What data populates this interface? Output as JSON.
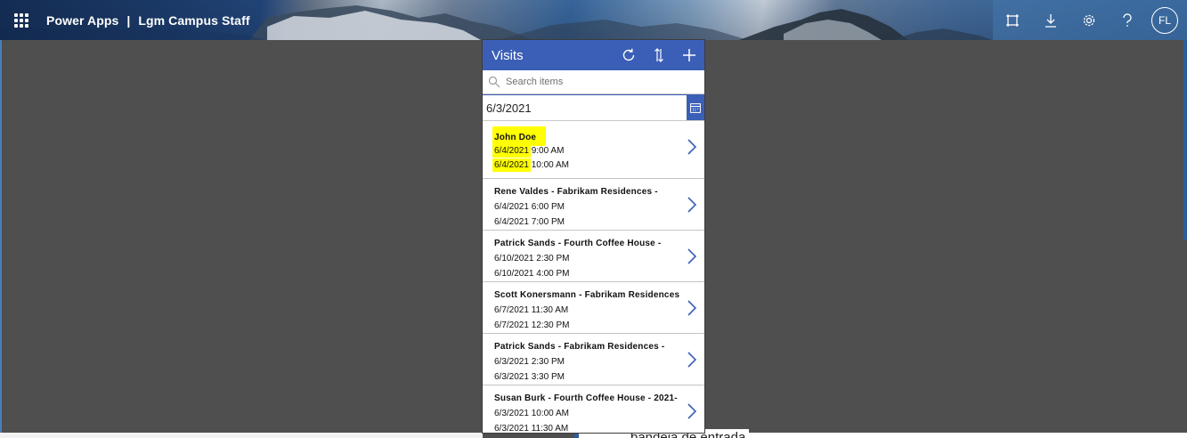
{
  "header": {
    "app_name": "Power Apps",
    "separator": "|",
    "environment": "Lgm Campus Staff",
    "avatar_initials": "FL",
    "icons": [
      "waffle-icon",
      "fit-screen-icon",
      "download-icon",
      "settings-icon",
      "help-icon"
    ]
  },
  "background_page": {
    "partial_text": "bandeja de entrada"
  },
  "app": {
    "title": "Visits",
    "search_placeholder": "Search items",
    "date_value": "6/3/2021",
    "accent_color": "#3b5fb7",
    "highlight_color": "#ffff00",
    "items": [
      {
        "name": "John Doe",
        "start": "6/4/2021 9:00 AM",
        "end": "6/4/2021 10:00 AM"
      },
      {
        "name": "Rene Valdes - Fabrikam Residences -",
        "start": "6/4/2021 6:00 PM",
        "end": "6/4/2021 7:00 PM"
      },
      {
        "name": "Patrick Sands - Fourth Coffee House -",
        "start": "6/10/2021 2:30 PM",
        "end": "6/10/2021 4:00 PM"
      },
      {
        "name": "Scott Konersmann - Fabrikam Residences",
        "start": "6/7/2021 11:30 AM",
        "end": "6/7/2021 12:30 PM"
      },
      {
        "name": "Patrick Sands - Fabrikam Residences -",
        "start": "6/3/2021 2:30 PM",
        "end": "6/3/2021 3:30 PM"
      },
      {
        "name": "Susan Burk - Fourth Coffee House - 2021-",
        "start": "6/3/2021 10:00 AM",
        "end": "6/3/2021 11:30 AM"
      }
    ]
  }
}
